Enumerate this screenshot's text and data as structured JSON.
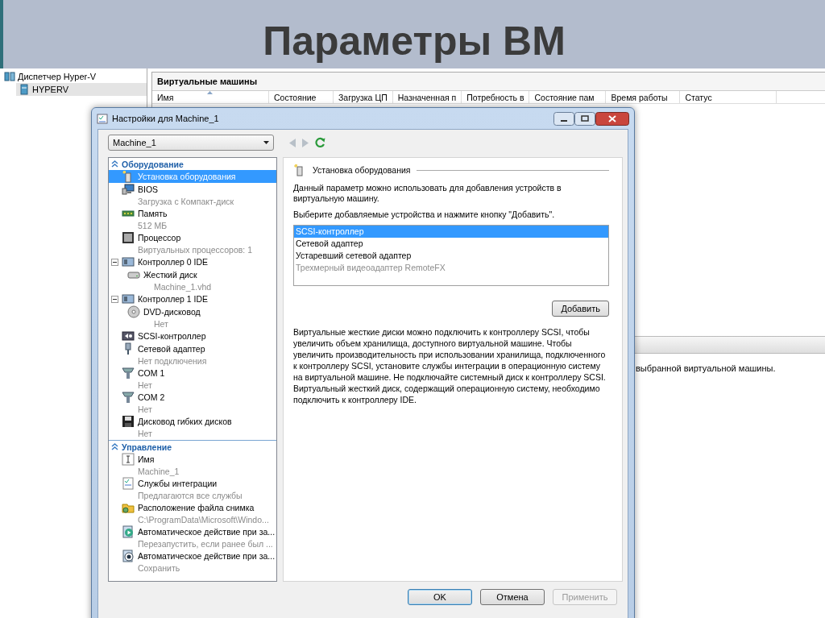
{
  "slide": {
    "title": "Параметры ВМ"
  },
  "manager": {
    "tree": [
      {
        "label": "Диспетчер Hyper-V",
        "selected": false,
        "children": [
          {
            "label": "HYPERV",
            "selected": true
          }
        ]
      }
    ],
    "vm_panel": {
      "title": "Виртуальные машины",
      "columns": [
        {
          "label": "Имя",
          "sorted": true
        },
        {
          "label": "Состояние",
          "sorted": false
        },
        {
          "label": "Загрузка ЦП",
          "sorted": false
        },
        {
          "label": "Назначенная п",
          "sorted": false
        },
        {
          "label": "Потребность в",
          "sorted": false
        },
        {
          "label": "Состояние пам",
          "sorted": false
        },
        {
          "label": "Время работы",
          "sorted": false
        },
        {
          "label": "Статус",
          "sorted": false
        }
      ]
    },
    "details_panel": {
      "text": "выбранной виртуальной машины."
    }
  },
  "dialog": {
    "title": "Настройки для Machine_1",
    "machine": "Machine_1",
    "nav": {
      "back_disabled": true,
      "forward_disabled": true
    },
    "sections": [
      {
        "title": "Оборудование",
        "expanded": true,
        "items": [
          {
            "label": "Установка оборудования",
            "selected": true
          },
          {
            "label": "BIOS",
            "detail": "Загрузка с Компакт-диск",
            "selected": false
          },
          {
            "label": "Память",
            "detail": "512 МБ",
            "selected": false
          },
          {
            "label": "Процессор",
            "detail": "Виртуальных процессоров: 1",
            "selected": false
          },
          {
            "label": "Контроллер 0 IDE",
            "selected": false,
            "expanded": true,
            "children": [
              {
                "label": "Жесткий диск",
                "detail": "Machine_1.vhd",
                "selected": false
              }
            ]
          },
          {
            "label": "Контроллер 1 IDE",
            "selected": false,
            "expanded": true,
            "children": [
              {
                "label": "DVD-дисковод",
                "detail": "Нет",
                "selected": false
              }
            ]
          },
          {
            "label": "SCSI-контроллер",
            "selected": false
          },
          {
            "label": "Сетевой адаптер",
            "detail": "Нет подключения",
            "selected": false
          },
          {
            "label": "COM 1",
            "detail": "Нет",
            "selected": false
          },
          {
            "label": "COM 2",
            "detail": "Нет",
            "selected": false
          },
          {
            "label": "Дисковод гибких дисков",
            "detail": "Нет",
            "selected": false
          }
        ]
      },
      {
        "title": "Управление",
        "expanded": true,
        "items": [
          {
            "label": "Имя",
            "detail": "Machine_1",
            "selected": false
          },
          {
            "label": "Службы интеграции",
            "detail": "Предлагаются все службы",
            "selected": false
          },
          {
            "label": "Расположение файла снимка",
            "detail": "C:\\ProgramData\\Microsoft\\Windo...",
            "selected": false
          },
          {
            "label": "Автоматическое действие при за...",
            "detail": "Перезапустить, если ранее был ...",
            "selected": false
          },
          {
            "label": "Автоматическое действие при за...",
            "detail": "Сохранить",
            "selected": false
          }
        ]
      }
    ],
    "page": {
      "title": "Установка оборудования",
      "description": "Данный параметр можно использовать для добавления устройств в виртуальную машину.",
      "instruction": "Выберите добавляемые устройства и нажмите кнопку \"Добавить\".",
      "devices": [
        {
          "label": "SCSI-контроллер",
          "selected": true,
          "disabled": false
        },
        {
          "label": "Сетевой адаптер",
          "selected": false,
          "disabled": false
        },
        {
          "label": "Устаревший сетевой адаптер",
          "selected": false,
          "disabled": false
        },
        {
          "label": "Трехмерный видеоадаптер RemoteFX",
          "selected": false,
          "disabled": true
        }
      ],
      "add_button": "Добавить",
      "note": "Виртуальные жесткие диски можно подключить к контроллеру SCSI, чтобы увеличить объем хранилища, доступного виртуальной машине. Чтобы увеличить производительность при использовании хранилища, подключенного к контроллеру SCSI, установите службы интеграции в операционную систему на виртуальной машине. Не подключайте системный диск к контроллеру SCSI. Виртуальный жесткий диск, содержащий операционную систему, необходимо подключить к контроллеру IDE."
    },
    "buttons": [
      {
        "label": "OK",
        "default": true,
        "disabled": false
      },
      {
        "label": "Отмена",
        "default": false,
        "disabled": false
      },
      {
        "label": "Применить",
        "default": false,
        "disabled": true
      }
    ]
  }
}
